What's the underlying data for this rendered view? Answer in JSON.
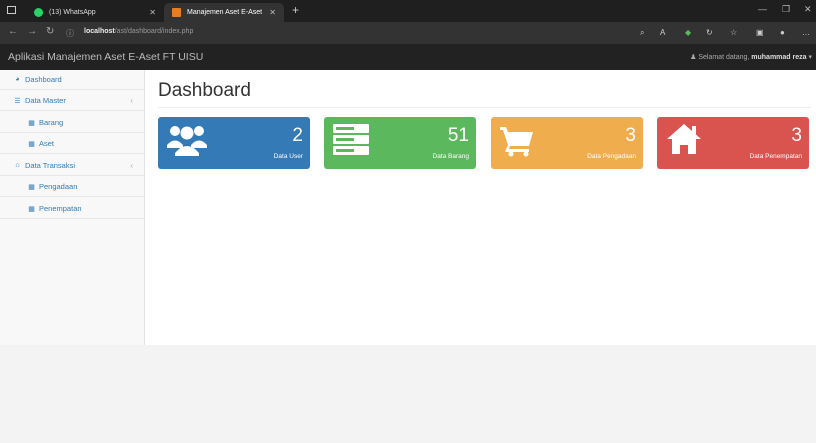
{
  "browser": {
    "tabs": [
      {
        "label": "(13) WhatsApp",
        "favicon_color": "#25d366"
      },
      {
        "label": "Manajemen Aset E-Aset",
        "favicon_color": "#e67e22"
      }
    ],
    "url_host": "localhost",
    "url_path": "/ast/dashboard/index.php"
  },
  "app": {
    "brand": "Aplikasi Manajemen Aset E-Aset FT UISU",
    "greeting": "Selamat datang,",
    "username": "muhammad reza"
  },
  "sidebar": {
    "items": [
      {
        "label": "Dashboard",
        "icon": "dashboard-icon"
      },
      {
        "label": "Data Master",
        "icon": "list-icon"
      },
      {
        "label": "Barang",
        "icon": "table-icon"
      },
      {
        "label": "Aset",
        "icon": "table-icon"
      },
      {
        "label": "Data Transaksi",
        "icon": "bank-icon"
      },
      {
        "label": "Pengadaan",
        "icon": "table-icon"
      },
      {
        "label": "Penempatan",
        "icon": "table-icon"
      }
    ]
  },
  "main": {
    "title": "Dashboard",
    "cards": [
      {
        "value": "2",
        "label": "Data User",
        "color": "#337ab7",
        "icon": "users-icon"
      },
      {
        "value": "51",
        "label": "Data Barang",
        "color": "#5cb85c",
        "icon": "server-icon"
      },
      {
        "value": "3",
        "label": "Data Pengadaan",
        "color": "#f0ad4e",
        "icon": "cart-icon"
      },
      {
        "value": "3",
        "label": "Data Penempatan",
        "color": "#d9534f",
        "icon": "home-icon"
      }
    ]
  }
}
